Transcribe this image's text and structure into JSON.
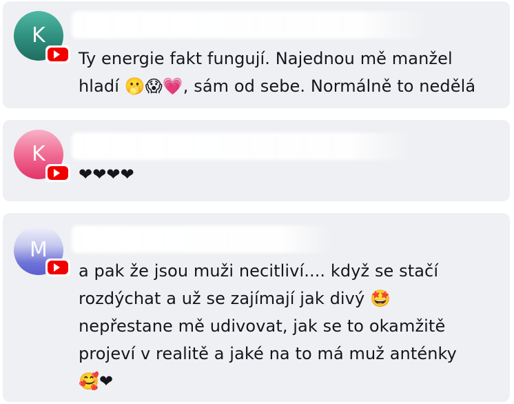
{
  "comments": [
    {
      "avatar_initial": "K",
      "avatar_color": "#2e8d7c",
      "platform_icon": "youtube-icon",
      "text": "Ty energie fakt fungují. Najednou mě manžel\nhladí 🫢😱💗, sám od sebe. Normálně to nedělá"
    },
    {
      "avatar_initial": "K",
      "avatar_color": "#f06c95",
      "platform_icon": "youtube-icon",
      "text": "❤❤❤❤"
    },
    {
      "avatar_initial": "M",
      "avatar_color": "#6f74d8",
      "platform_icon": "youtube-icon",
      "text": "a pak že jsou muži necitliví.... když se stačí\nrozdýchat a už se zajímají jak divý 🤩\nnepřestane mě udivovat, jak se to okamžitě\nprojeví v realitě a jaké na to má muž anténky\n🥰❤"
    }
  ],
  "colors": {
    "card_background": "#eff0f3",
    "text": "#15151c",
    "youtube_red": "#f20000"
  }
}
